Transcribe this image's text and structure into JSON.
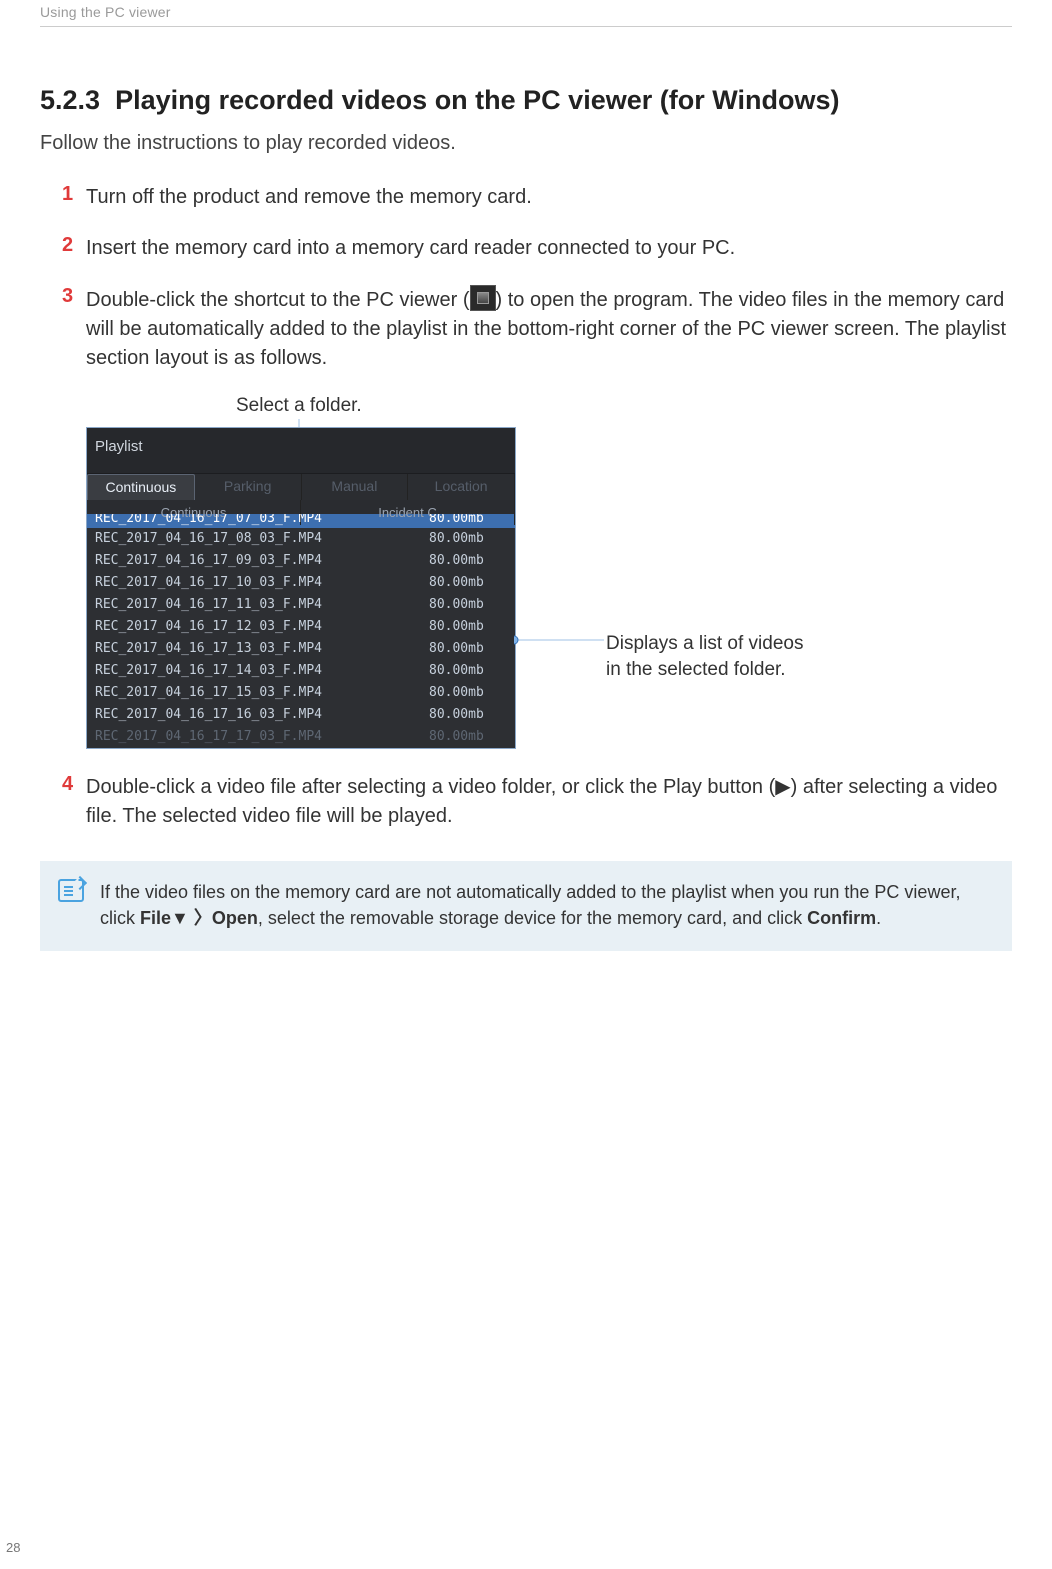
{
  "running_head": "Using the PC viewer",
  "section_number": "5.2.3",
  "section_title": "Playing recorded videos on the PC viewer (for Windows)",
  "intro": "Follow the instructions to play recorded videos.",
  "steps": {
    "s1": {
      "num": "1",
      "text": "Turn off the product and remove the memory card."
    },
    "s2": {
      "num": "2",
      "text": "Insert the memory card into a memory card reader connected to your PC."
    },
    "s3": {
      "num": "3",
      "pre": "Double-click the shortcut to the PC viewer (",
      "post": ") to open the program. The video files in the memory card will be automatically added to the playlist in the bottom-right corner of the PC viewer screen. The playlist section layout is as follows."
    },
    "s4": {
      "num": "4",
      "text": "Double-click a video file after selecting a video folder, or click the Play button (▶) after selecting a video file. The selected video file will be played."
    }
  },
  "callouts": {
    "top": "Select a folder.",
    "right_line1": "Displays a list of videos",
    "right_line2": "in the selected folder."
  },
  "playlist": {
    "title": "Playlist",
    "tabs1": {
      "a": "Continuous",
      "b": "Parking",
      "c": "Manual",
      "d": "Location"
    },
    "tabs2": {
      "a": "Continuous",
      "b": "Incident C"
    },
    "files": [
      {
        "name": "REC_2017_04_16_17_07_03_F.MP4",
        "size": "80.00mb",
        "selected": true
      },
      {
        "name": "REC_2017_04_16_17_08_03_F.MP4",
        "size": "80.00mb"
      },
      {
        "name": "REC_2017_04_16_17_09_03_F.MP4",
        "size": "80.00mb"
      },
      {
        "name": "REC_2017_04_16_17_10_03_F.MP4",
        "size": "80.00mb"
      },
      {
        "name": "REC_2017_04_16_17_11_03_F.MP4",
        "size": "80.00mb"
      },
      {
        "name": "REC_2017_04_16_17_12_03_F.MP4",
        "size": "80.00mb"
      },
      {
        "name": "REC_2017_04_16_17_13_03_F.MP4",
        "size": "80.00mb"
      },
      {
        "name": "REC_2017_04_16_17_14_03_F.MP4",
        "size": "80.00mb"
      },
      {
        "name": "REC_2017_04_16_17_15_03_F.MP4",
        "size": "80.00mb"
      },
      {
        "name": "REC_2017_04_16_17_16_03_F.MP4",
        "size": "80.00mb"
      },
      {
        "name": "REC_2017_04_16_17_17_03_F.MP4",
        "size": "80.00mb",
        "last": true
      }
    ]
  },
  "note": {
    "pre": "If the video files on the memory card are not automatically added to the playlist when you run the PC viewer, click ",
    "file": "File▼",
    "sep": " 〉",
    "open": "Open",
    "mid": ", select the removable storage device for the memory card, and click ",
    "confirm": "Confirm",
    "post": "."
  },
  "page_number": "28"
}
